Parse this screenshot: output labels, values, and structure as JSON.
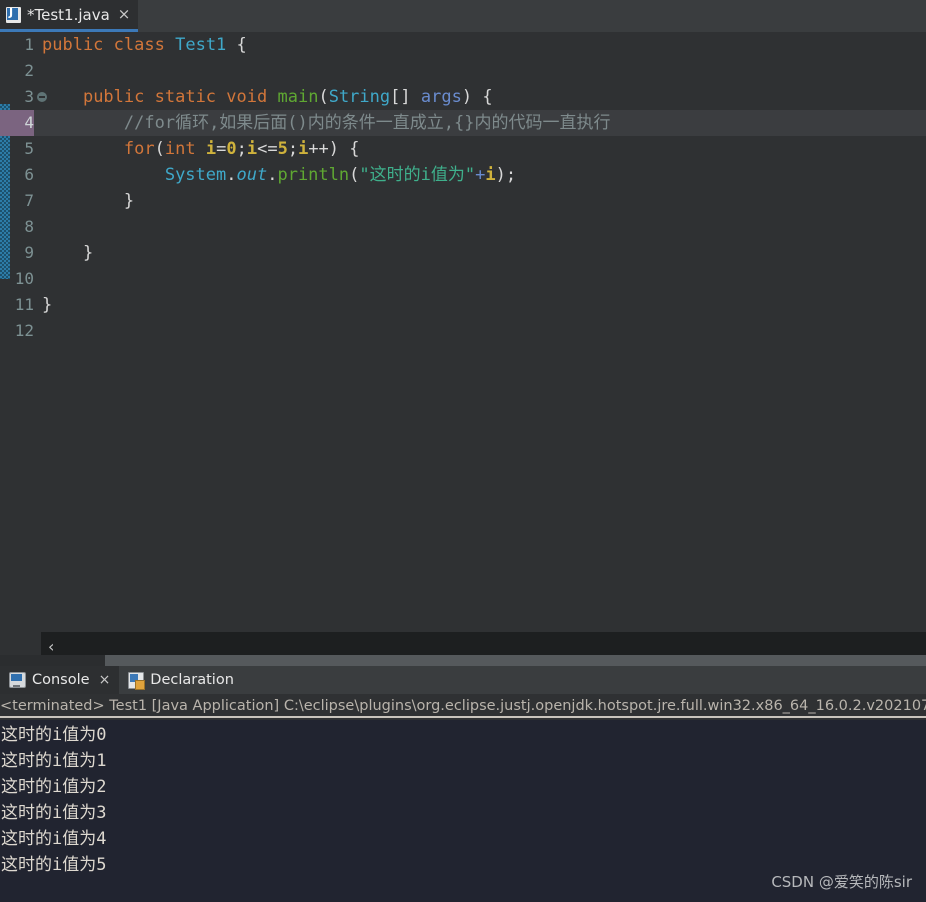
{
  "editor": {
    "tab": {
      "title": "*Test1.java",
      "icon": "java-file-icon",
      "close": "×"
    },
    "scroll": {
      "left_arrow": "‹"
    },
    "gutter_icons": {
      "fold_marker": "collapse-minus-icon",
      "quickfix": "quickfix-bulb-icon"
    },
    "lines": [
      {
        "num": "1",
        "current": false,
        "fold": false
      },
      {
        "num": "2",
        "current": false,
        "fold": false
      },
      {
        "num": "3",
        "current": false,
        "fold": true
      },
      {
        "num": "4",
        "current": true,
        "fold": false
      },
      {
        "num": "5",
        "current": false,
        "fold": false
      },
      {
        "num": "6",
        "current": false,
        "fold": false
      },
      {
        "num": "7",
        "current": false,
        "fold": false
      },
      {
        "num": "8",
        "current": false,
        "fold": false
      },
      {
        "num": "9",
        "current": false,
        "fold": false
      },
      {
        "num": "10",
        "current": false,
        "fold": false
      },
      {
        "num": "11",
        "current": false,
        "fold": false
      },
      {
        "num": "12",
        "current": false,
        "fold": false
      }
    ],
    "code": {
      "l1_public": "public",
      "l1_class": "class",
      "l1_name": "Test1",
      "l1_brace": "{",
      "l3_public": "public",
      "l3_static": "static",
      "l3_void": "void",
      "l3_main": "main",
      "l3_paren_open": "(",
      "l3_string": "String",
      "l3_brackets": "[]",
      "l3_args": "args",
      "l3_paren_close": ")",
      "l3_brace": "{",
      "l4_comment": "//for循环,如果后面()内的条件一直成立,{}内的代码一直执行",
      "l5_for": "for",
      "l5_paren_open": "(",
      "l5_int": "int",
      "l5_i1": "i",
      "l5_eq": "=",
      "l5_zero": "0",
      "l5_semi1": ";",
      "l5_i2": "i",
      "l5_lte": "<=",
      "l5_five": "5",
      "l5_semi2": ";",
      "l5_i3": "i",
      "l5_inc": "++",
      "l5_paren_close": ")",
      "l5_brace": "{",
      "l6_system": "System",
      "l6_dot1": ".",
      "l6_out": "out",
      "l6_dot2": ".",
      "l6_println": "println",
      "l6_paren_open": "(",
      "l6_string": "\"这时的i值为\"",
      "l6_plus": "+",
      "l6_i": "i",
      "l6_tail": ");",
      "l7_brace": "}",
      "l9_brace": "}",
      "l11_brace": "}"
    }
  },
  "panel": {
    "tabs": [
      {
        "label": "Console",
        "icon": "console-monitor-icon",
        "active": true,
        "closable": true
      },
      {
        "label": "Declaration",
        "icon": "declaration-doc-icon",
        "active": false,
        "closable": false
      }
    ],
    "close_glyph": "×",
    "launch_line": "<terminated> Test1 [Java Application] C:\\eclipse\\plugins\\org.eclipse.justj.openjdk.hotspot.jre.full.win32.x86_64_16.0.2.v202107",
    "output": [
      "这时的i值为0",
      "这时的i值为1",
      "这时的i值为2",
      "这时的i值为3",
      "这时的i值为4",
      "这时的i值为5"
    ]
  },
  "watermark": "CSDN @爱笑的陈sir",
  "colors": {
    "editor_bg": "#2f3133",
    "console_bg": "#212430",
    "tab_underline": "#3c79b8",
    "keyword": "#d2763a",
    "type": "#3fa8c9",
    "method": "#5fa832",
    "string": "#3fb08c",
    "variable": "#cfb23c",
    "parameter": "#6a8ccf",
    "comment": "#7e8a8c",
    "current_line_num_bg": "#7b6480",
    "change_ruler": "#2d7ca8"
  }
}
